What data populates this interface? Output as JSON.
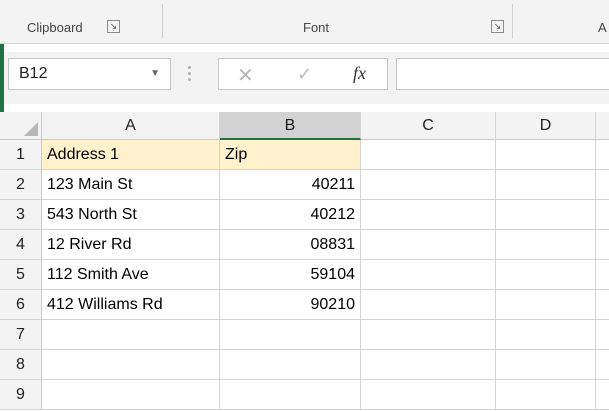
{
  "ribbon": {
    "groups": [
      {
        "label": "Clipboard"
      },
      {
        "label": "Font"
      },
      {
        "label": "A"
      }
    ]
  },
  "formula_bar": {
    "name_box": "B12",
    "formula": ""
  },
  "columns": [
    "A",
    "B",
    "C",
    "D"
  ],
  "selected_column": "B",
  "rows": [
    {
      "num": "1",
      "a": "Address 1",
      "b": "Zip"
    },
    {
      "num": "2",
      "a": "123 Main St",
      "b": "40211"
    },
    {
      "num": "3",
      "a": "543 North St",
      "b": "40212"
    },
    {
      "num": "4",
      "a": "12 River Rd",
      "b": "08831"
    },
    {
      "num": "5",
      "a": "112 Smith Ave",
      "b": "59104"
    },
    {
      "num": "6",
      "a": "412 Williams Rd",
      "b": "90210"
    },
    {
      "num": "7",
      "a": "",
      "b": ""
    },
    {
      "num": "8",
      "a": "",
      "b": ""
    },
    {
      "num": "9",
      "a": "",
      "b": ""
    }
  ],
  "colors": {
    "header_fill": "#fff2cc",
    "accent": "#217346"
  }
}
